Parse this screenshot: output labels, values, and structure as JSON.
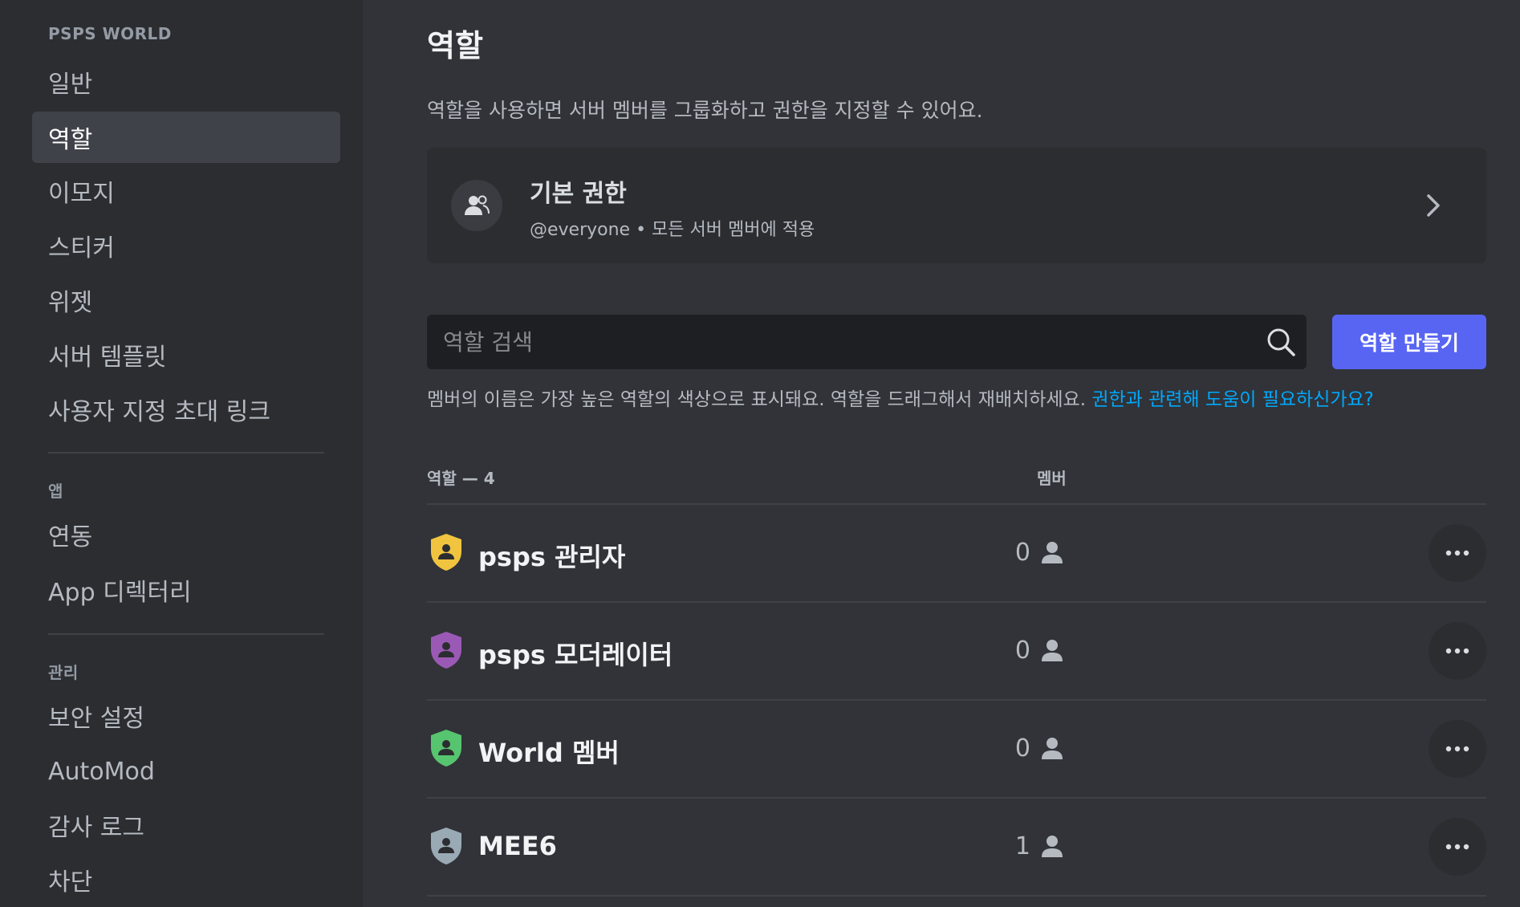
{
  "sidebar": {
    "server_header": "PSPS WORLD",
    "items": [
      {
        "label": "일반"
      },
      {
        "label": "역할",
        "selected": true
      },
      {
        "label": "이모지"
      },
      {
        "label": "스티커"
      },
      {
        "label": "위젯"
      },
      {
        "label": "서버 템플릿"
      },
      {
        "label": "사용자 지정 초대 링크"
      }
    ],
    "apps_header": "앱",
    "apps_items": [
      {
        "label": "연동"
      },
      {
        "label": "App 디렉터리"
      }
    ],
    "manage_header": "관리",
    "manage_items": [
      {
        "label": "보안 설정"
      },
      {
        "label": "AutoMod"
      },
      {
        "label": "감사 로그"
      },
      {
        "label": "차단"
      }
    ]
  },
  "main": {
    "title": "역할",
    "description": "역할을 사용하면 서버 멤버를 그룹화하고 권한을 지정할 수 있어요.",
    "default_permissions": {
      "title": "기본 권한",
      "subtitle": "@everyone • 모든 서버 멤버에 적용",
      "icon": "users-icon"
    },
    "search": {
      "placeholder": "역할 검색",
      "value": ""
    },
    "create_role_label": "역할 만들기",
    "hint_text": "멤버의 이름은 가장 높은 역할의 색상으로 표시돼요. 역할을 드래그해서 재배치하세요. ",
    "hint_link": "권한과 관련해 도움이 필요하신가요?",
    "table": {
      "col_roles": "역할 — 4",
      "col_members": "멤버",
      "rows": [
        {
          "name": "psps 관리자",
          "members": "0",
          "color": "#f0c43f"
        },
        {
          "name": "psps 모더레이터",
          "members": "0",
          "color": "#9b59b6"
        },
        {
          "name": "World 멤버",
          "members": "0",
          "color": "#57c46f"
        },
        {
          "name": "MEE6",
          "members": "1",
          "color": "#99aab5"
        }
      ]
    }
  },
  "colors": {
    "accent": "#5865f2",
    "link": "#00a8fc",
    "background": "#313338",
    "sidebar": "#2b2d31"
  }
}
